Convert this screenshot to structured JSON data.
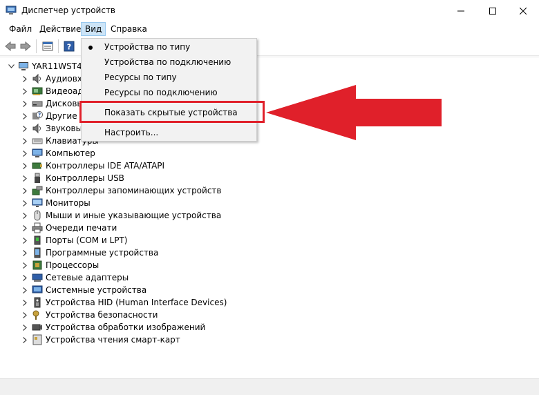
{
  "window": {
    "title": "Диспетчер устройств"
  },
  "menubar": {
    "items": [
      "Файл",
      "Действие",
      "Вид",
      "Справка"
    ]
  },
  "tree": {
    "root_label": "YAR11WST42",
    "rows": [
      {
        "label": "Аудиовхо",
        "icon": "speaker-icon"
      },
      {
        "label": "Видеоада",
        "icon": "display-adapter-icon"
      },
      {
        "label": "Дисковы",
        "icon": "disk-drive-icon"
      },
      {
        "label": "Другие у",
        "icon": "unknown-device-icon"
      },
      {
        "label": "Звуковые",
        "icon": "speaker-icon"
      },
      {
        "label": "Клавиатуры",
        "icon": "keyboard-icon"
      },
      {
        "label": "Компьютер",
        "icon": "computer-icon"
      },
      {
        "label": "Контроллеры IDE ATA/ATAPI",
        "icon": "ide-controller-icon"
      },
      {
        "label": "Контроллеры USB",
        "icon": "usb-icon"
      },
      {
        "label": "Контроллеры запоминающих устройств",
        "icon": "storage-controller-icon"
      },
      {
        "label": "Мониторы",
        "icon": "monitor-icon"
      },
      {
        "label": "Мыши и иные указывающие устройства",
        "icon": "mouse-icon"
      },
      {
        "label": "Очереди печати",
        "icon": "printer-icon"
      },
      {
        "label": "Порты (COM и LPT)",
        "icon": "port-icon"
      },
      {
        "label": "Программные устройства",
        "icon": "software-device-icon"
      },
      {
        "label": "Процессоры",
        "icon": "processor-icon"
      },
      {
        "label": "Сетевые адаптеры",
        "icon": "network-adapter-icon"
      },
      {
        "label": "Системные устройства",
        "icon": "system-device-icon"
      },
      {
        "label": "Устройства HID (Human Interface Devices)",
        "icon": "hid-icon"
      },
      {
        "label": "Устройства безопасности",
        "icon": "security-device-icon"
      },
      {
        "label": "Устройства обработки изображений",
        "icon": "camera-icon"
      },
      {
        "label": "Устройства чтения смарт-карт",
        "icon": "smart-card-icon"
      }
    ]
  },
  "view_menu": {
    "items": [
      {
        "label": "Устройства по типу",
        "checked": true
      },
      {
        "label": "Устройства по подключению",
        "checked": false
      },
      {
        "label": "Ресурсы по типу",
        "checked": false
      },
      {
        "label": "Ресурсы по подключению",
        "checked": false
      },
      {
        "label": "Показать скрытые устройства",
        "checked": false,
        "highlighted": true
      },
      {
        "label": "Настроить...",
        "checked": false
      }
    ]
  },
  "annotation": {
    "color": "#e0202a"
  }
}
